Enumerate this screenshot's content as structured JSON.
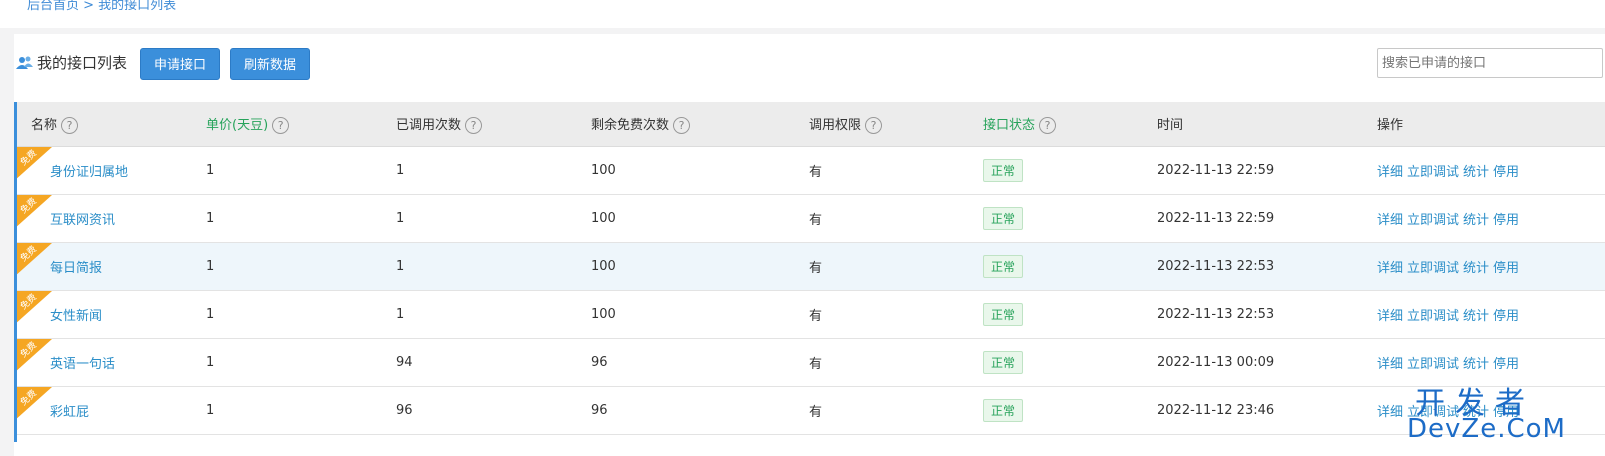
{
  "breadcrumb": "后台首页 > 我的接口列表",
  "panel": {
    "title": "我的接口列表",
    "apply_button": "申请接口",
    "refresh_button": "刷新数据",
    "search_placeholder": "搜索已申请的接口"
  },
  "table": {
    "headers": {
      "name": "名称",
      "price": "单价(天豆)",
      "calls": "已调用次数",
      "free": "剩余免费次数",
      "permission": "调用权限",
      "status": "接口状态",
      "time": "时间",
      "actions": "操作"
    },
    "help_glyph": "?",
    "ribbon_text": "免费",
    "rows": [
      {
        "name": "身份证归属地",
        "price": "1",
        "calls": "1",
        "free": "100",
        "permission": "有",
        "status": "正常",
        "time": "2022-11-13 22:59"
      },
      {
        "name": "互联网资讯",
        "price": "1",
        "calls": "1",
        "free": "100",
        "permission": "有",
        "status": "正常",
        "time": "2022-11-13 22:59"
      },
      {
        "name": "每日简报",
        "price": "1",
        "calls": "1",
        "free": "100",
        "permission": "有",
        "status": "正常",
        "time": "2022-11-13 22:53"
      },
      {
        "name": "女性新闻",
        "price": "1",
        "calls": "1",
        "free": "100",
        "permission": "有",
        "status": "正常",
        "time": "2022-11-13 22:53"
      },
      {
        "name": "英语一句话",
        "price": "1",
        "calls": "94",
        "free": "96",
        "permission": "有",
        "status": "正常",
        "time": "2022-11-13 00:09"
      },
      {
        "name": "彩虹屁",
        "price": "1",
        "calls": "96",
        "free": "96",
        "permission": "有",
        "status": "正常",
        "time": "2022-11-12 23:46"
      }
    ],
    "actions": {
      "detail": "详细",
      "debug": "立即调试",
      "stats": "统计",
      "disable": "停用"
    }
  },
  "watermark": {
    "line1": "开发者",
    "line2": "DevZe.CoM"
  },
  "colors": {
    "primary": "#3b8fdb",
    "link": "#2b8ec8",
    "green": "#27a35b",
    "ribbon": "#f5a623"
  }
}
